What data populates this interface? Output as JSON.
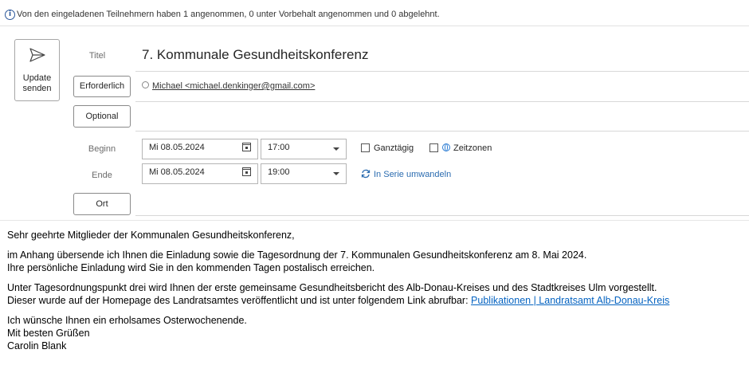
{
  "info_bar": {
    "icon": "info-icon",
    "text": "Von den eingeladenen Teilnehmern haben 1 angenommen, 0 unter Vorbehalt angenommen und 0 abgelehnt."
  },
  "send_button": {
    "icon": "send-icon",
    "label_line1": "Update",
    "label_line2": "senden"
  },
  "form": {
    "title_label": "Titel",
    "title_value": "7. Kommunale Gesundheitskonferenz",
    "required_button": "Erforderlich",
    "required_attendee": "Michael <michael.denkinger@gmail.com>",
    "optional_button": "Optional",
    "start_label": "Beginn",
    "start_date": "Mi 08.05.2024",
    "start_time": "17:00",
    "end_label": "Ende",
    "end_date": "Mi 08.05.2024",
    "end_time": "19:00",
    "all_day_label": "Ganztägig",
    "timezones_label": "Zeitzonen",
    "series_label": "In Serie umwandeln",
    "location_button": "Ort"
  },
  "body": {
    "greeting": "Sehr geehrte Mitglieder der Kommunalen Gesundheitskonferenz,",
    "p1_line1": "im Anhang übersende ich Ihnen die Einladung sowie die Tagesordnung der 7. Kommunalen Gesundheitskonferenz am 8. Mai 2024.",
    "p1_line2": "Ihre persönliche Einladung wird Sie in den kommenden Tagen postalisch erreichen.",
    "p2_line1": "Unter Tagesordnungspunkt drei wird Ihnen der erste gemeinsame Gesundheitsbericht des Alb-Donau-Kreises und des Stadtkreises Ulm vorgestellt.",
    "p2_line2": "Dieser wurde auf der Homepage des Landratsamtes veröffentlicht und ist unter folgendem Link abrufbar: ",
    "link_text": "Publikationen | Landratsamt Alb-Donau-Kreis",
    "closing_line1": "Ich wünsche Ihnen ein erholsames Osterwochenende.",
    "closing_line2": "Mit besten Grüßen",
    "closing_line3": "Carolin Blank"
  },
  "colors": {
    "link": "#0563c1",
    "accent": "#2b579a"
  }
}
